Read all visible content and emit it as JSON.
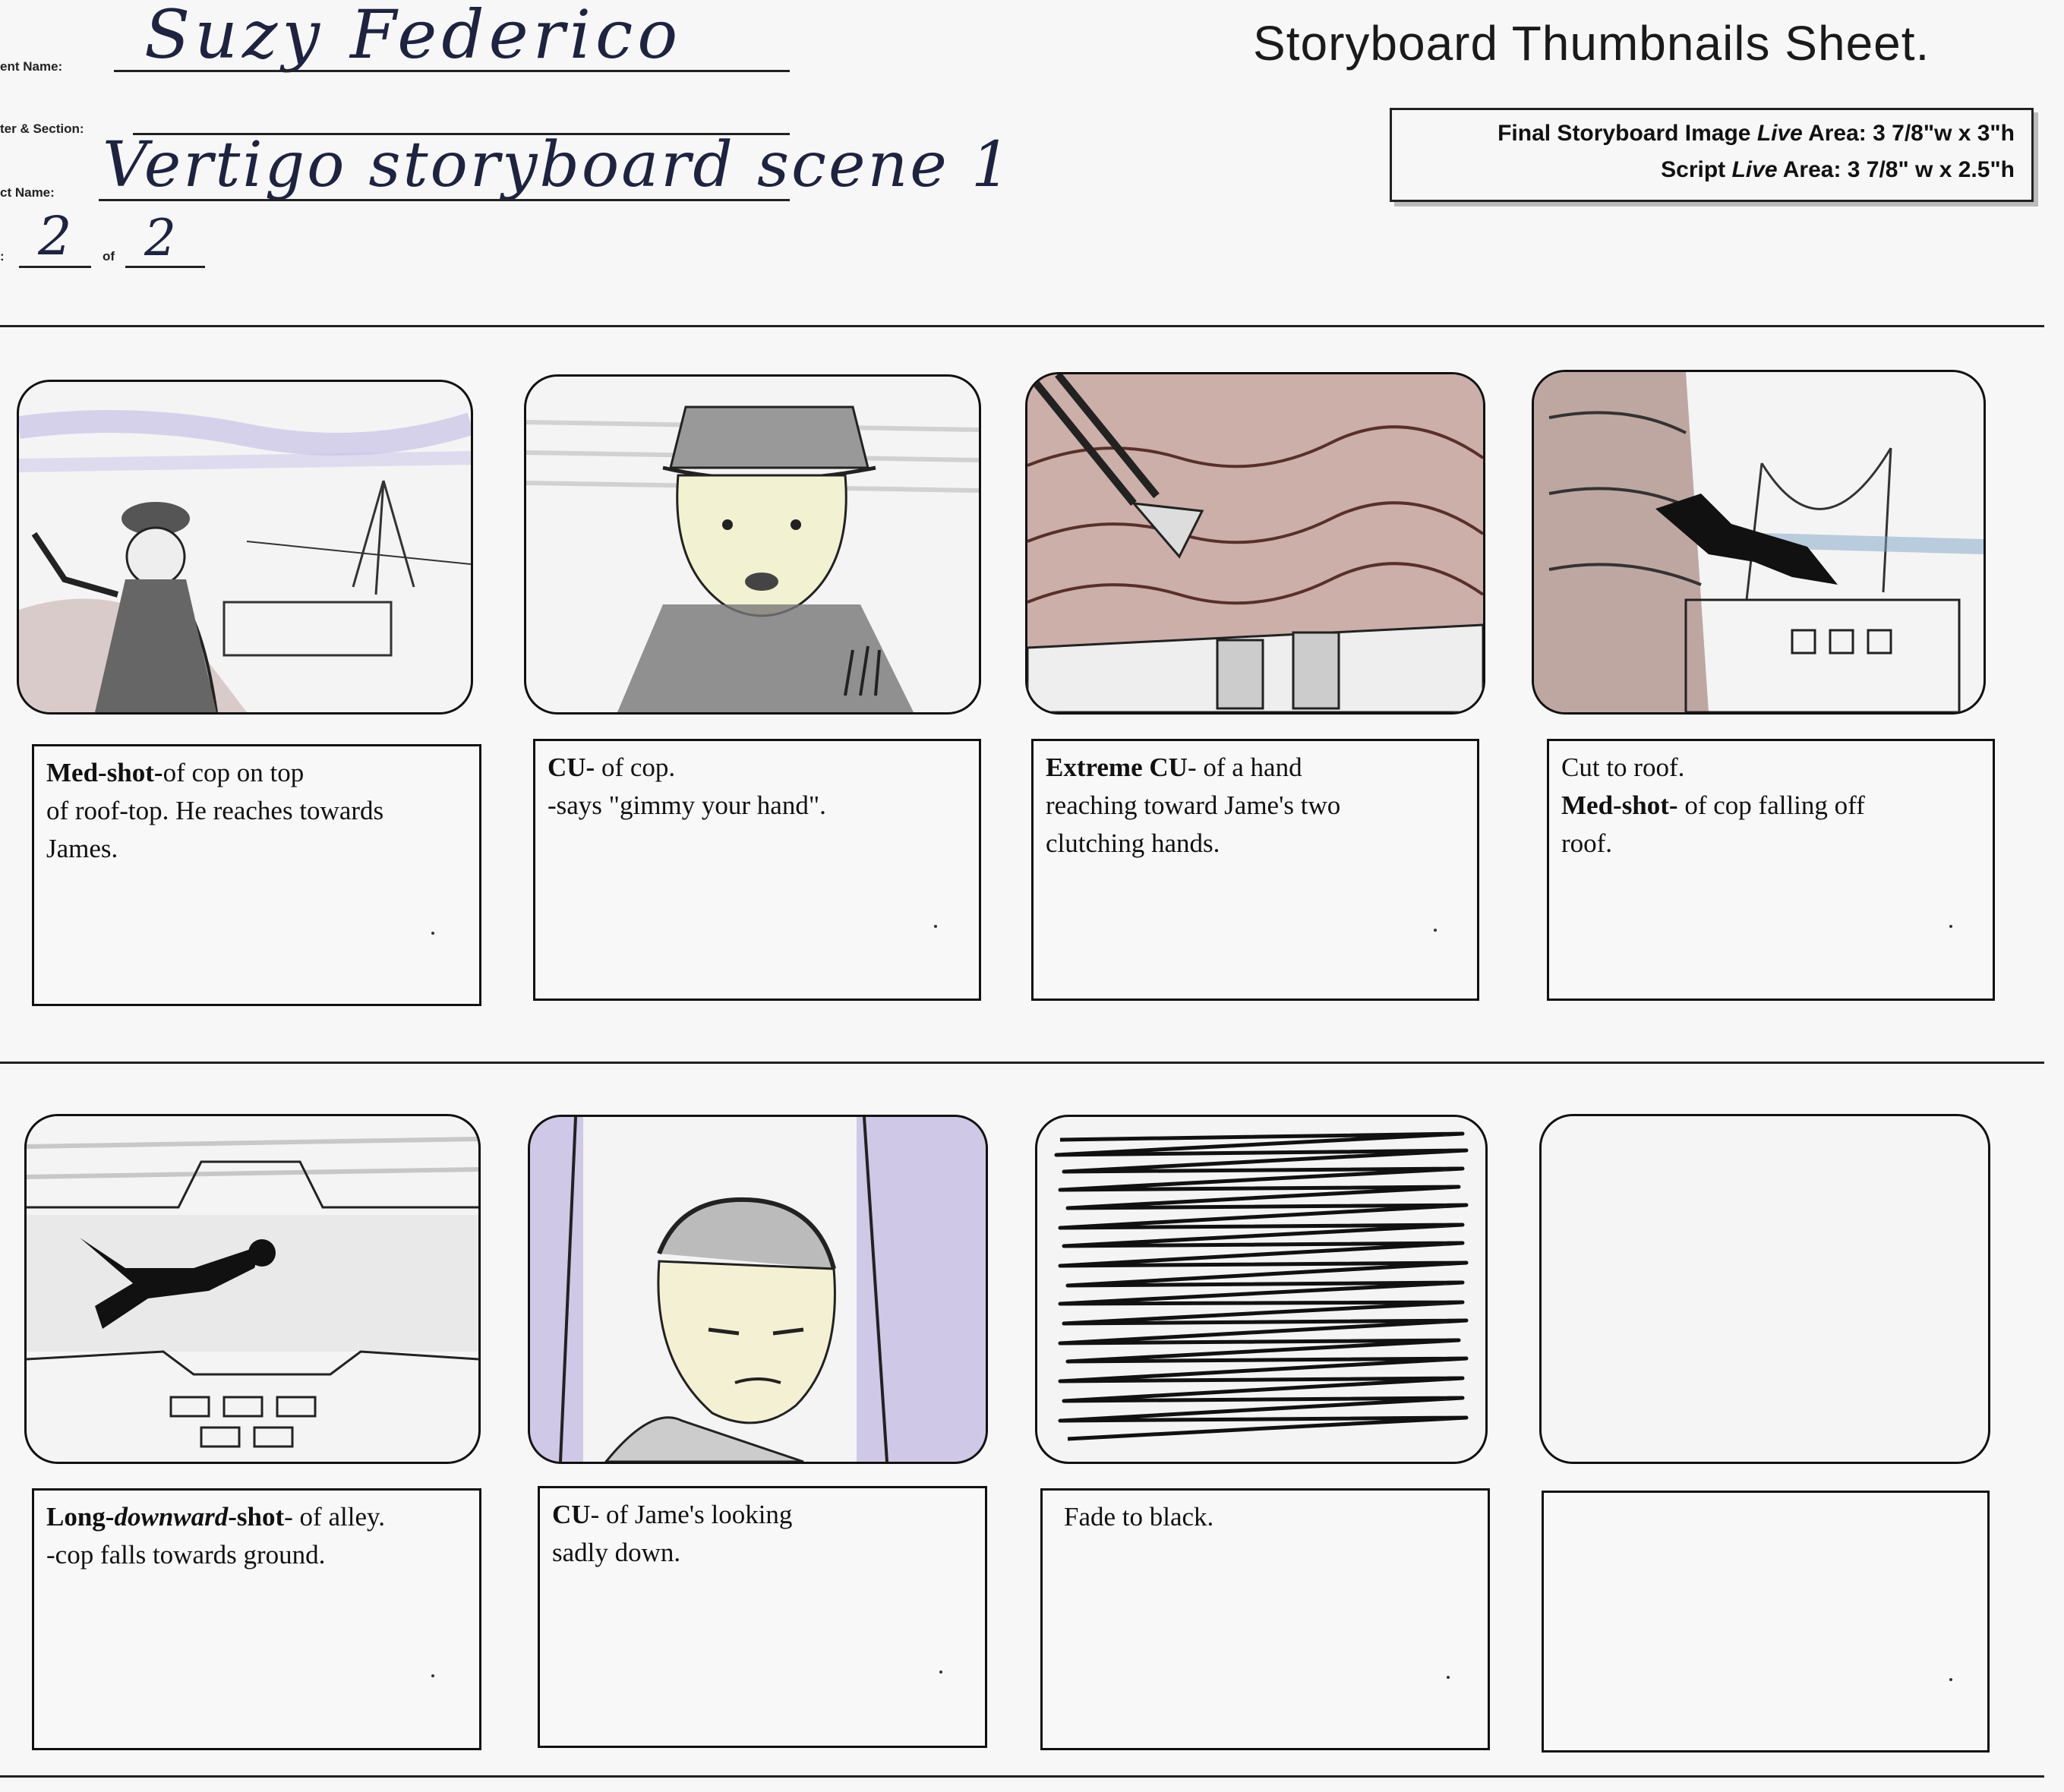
{
  "header": {
    "student_name_label": "ent Name:",
    "student_name_value": "Suzy Federico",
    "chapter_label": "ter & Section:",
    "project_name_label": "ct Name:",
    "project_name_value": "Vertigo storyboard scene 1",
    "page_prefix": ":",
    "page_number": "2",
    "page_of_label": "of",
    "page_total": "2",
    "sheet_title": "Storyboard Thumbnails Sheet.",
    "spec_line_1_a": "Final Storyboard Image ",
    "spec_line_1_b": "Live",
    "spec_line_1_c": " Area:  3 7/8\"w x 3\"h",
    "spec_line_2_a": "Script ",
    "spec_line_2_b": "Live",
    "spec_line_2_c": " Area:  3 7/8\" w x 2.5\"h"
  },
  "panels": [
    {
      "icon": "cop-on-rooftop-sketch-icon",
      "l1a": "Med-shot-",
      "l1b": "of cop on top",
      "l2": "of roof-top. He reaches towards",
      "l3": "James."
    },
    {
      "icon": "cop-closeup-sketch-icon",
      "l1a": "CU-",
      "l1b": " of cop.",
      "l2": "-says \"gimmy your hand\"."
    },
    {
      "icon": "hand-reaching-sketch-icon",
      "l1a": "Extreme CU",
      "l1b": "- of a hand",
      "l2": "reaching toward Jame's two",
      "l3": "clutching hands."
    },
    {
      "icon": "cop-falling-off-roof-sketch-icon",
      "l1": "Cut to roof.",
      "l2a": "Med-shot-",
      "l2b": " of cop falling off",
      "l3": "roof."
    },
    {
      "icon": "alley-downward-fall-sketch-icon",
      "l1a": "Long-",
      "l1b": "downward",
      "l1c": "-shot",
      "l1d": "- of alley.",
      "l2": "-cop falls towards ground."
    },
    {
      "icon": "james-sad-closeup-sketch-icon",
      "l1a": "CU",
      "l1b": "- of Jame's looking",
      "l2": "sadly down."
    },
    {
      "icon": "fade-to-black-scribble-icon",
      "l1": "Fade to black."
    },
    {
      "icon": "empty-frame"
    }
  ]
}
